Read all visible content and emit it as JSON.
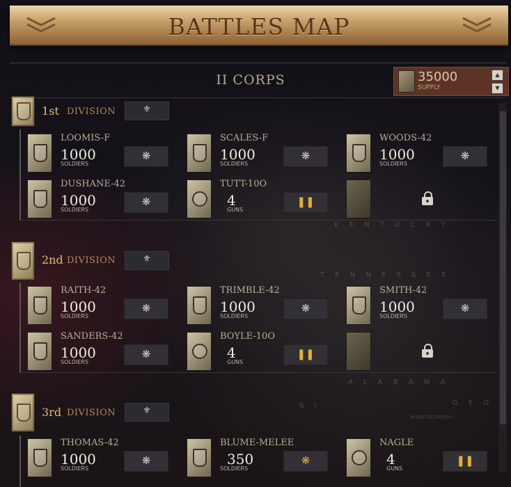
{
  "header": {
    "title": "BATTLES MAP"
  },
  "corps": {
    "title": "II CORPS",
    "supply_value": "35000",
    "supply_label": "SUPPLY"
  },
  "map_labels": [
    "K E N T U C K Y",
    "T E N N E S S E E",
    "A L A B A M A",
    "G E O R",
    "S I",
    "MONTGOMERY"
  ],
  "divisions": [
    {
      "num": "1st",
      "word": "DIVISION",
      "units": [
        {
          "name": "LOOMIS-F",
          "count": "1000",
          "sub": "SOLDIERS"
        },
        {
          "name": "SCALES-F",
          "count": "1000",
          "sub": "SOLDIERS"
        },
        {
          "name": "WOODS-42",
          "count": "1000",
          "sub": "SOLDIERS"
        },
        {
          "name": "DUSHANE-42",
          "count": "1000",
          "sub": "SOLDIERS"
        },
        {
          "name": "TUTT-10O",
          "count": "4",
          "sub": "GUNS"
        }
      ]
    },
    {
      "num": "2nd",
      "word": "DIVISION",
      "units": [
        {
          "name": "RAITH-42",
          "count": "1000",
          "sub": "SOLDIERS"
        },
        {
          "name": "TRIMBLE-42",
          "count": "1000",
          "sub": "SOLDIERS"
        },
        {
          "name": "SMITH-42",
          "count": "1000",
          "sub": "SOLDIERS"
        },
        {
          "name": "SANDERS-42",
          "count": "1000",
          "sub": "SOLDIERS"
        },
        {
          "name": "BOYLE-10O",
          "count": "4",
          "sub": "GUNS"
        }
      ]
    },
    {
      "num": "3rd",
      "word": "DIVISION",
      "units": [
        {
          "name": "THOMAS-42",
          "count": "1000",
          "sub": "SOLDIERS"
        },
        {
          "name": "BLUME-MELEE",
          "count": "350",
          "sub": "SOLDIERS"
        },
        {
          "name": "NAGLE",
          "count": "4",
          "sub": "GUNS"
        }
      ]
    }
  ]
}
